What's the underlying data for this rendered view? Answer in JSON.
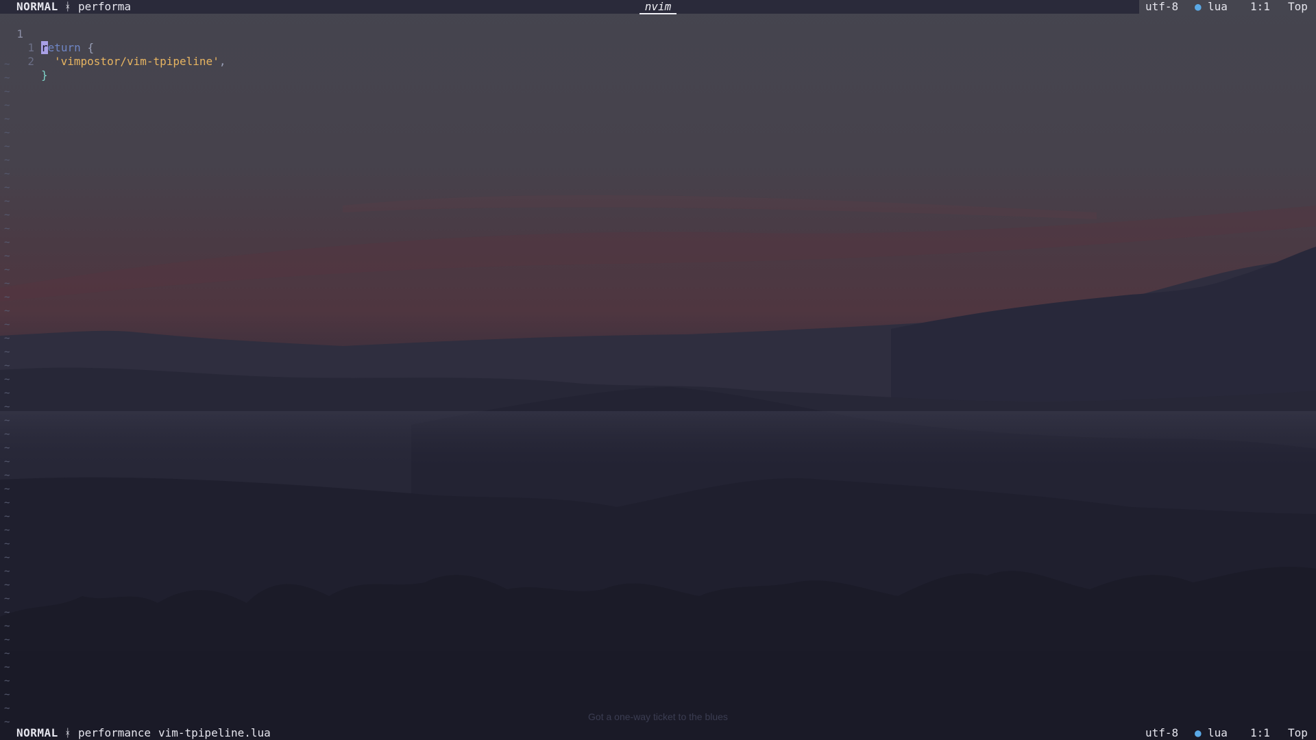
{
  "top_status": {
    "mode": "NORMAL",
    "branch_icon": "git-branch-icon",
    "branch": "performa",
    "title": "nvim",
    "encoding": "utf-8",
    "filetype_icon": "lua-icon",
    "filetype": "lua",
    "position": "1:1",
    "scroll": "Top"
  },
  "editor": {
    "lines": [
      {
        "number": "1",
        "keyword_cursor": "r",
        "keyword_rest": "eturn",
        "rest": " {"
      },
      {
        "number": "1",
        "string": "'vimpostor/vim-tpipeline'",
        "punct": ","
      },
      {
        "number": "2",
        "brace": "}"
      }
    ],
    "tilde": "~"
  },
  "bottom_status": {
    "mode": "NORMAL",
    "branch_icon": "git-branch-icon",
    "branch": "performance",
    "filename": "vim-tpipeline.lua",
    "encoding": "utf-8",
    "filetype_icon": "lua-icon",
    "filetype": "lua",
    "position": "1:1",
    "scroll": "Top"
  },
  "wallpaper_quote": "Got a one-way ticket to the blues",
  "colors": {
    "sky_top": "#45454f",
    "sky_glow": "#5a3a42",
    "mountains": "#2a2a3c",
    "foreground": "#1b1b29",
    "string": "#e8b561",
    "keyword": "#6f86c5",
    "cursor": "#a9a0e6"
  }
}
